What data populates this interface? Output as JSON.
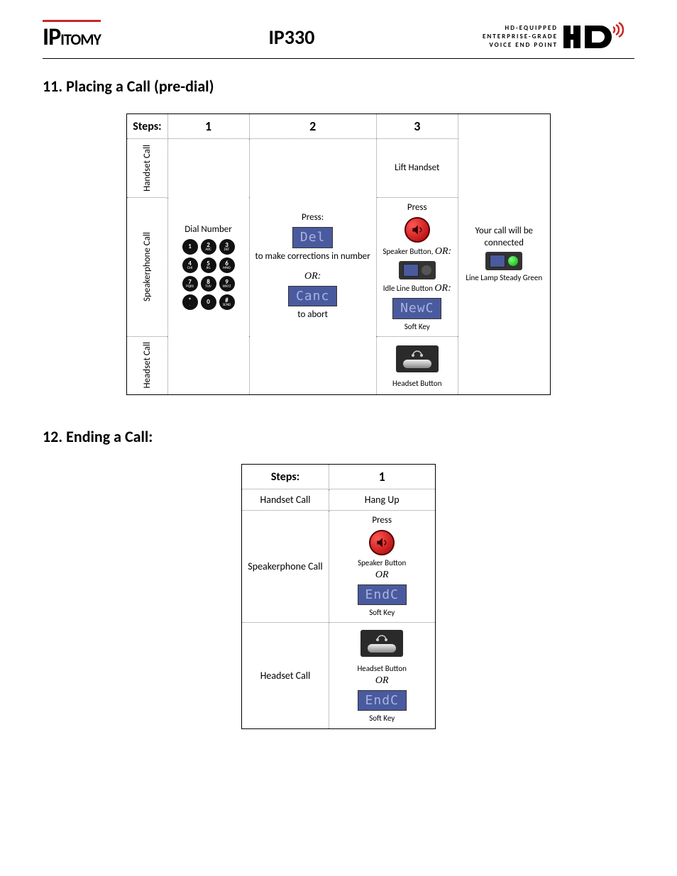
{
  "header": {
    "logo_ip": "IP",
    "logo_itomy": "ITOMY",
    "model": "IP330",
    "tag1": "HD-EQUIPPED",
    "tag2": "ENTERPRISE-GRADE",
    "tag3": "VOICE END POINT",
    "hd": "HD"
  },
  "section11": {
    "title": "11. Placing a Call (pre-dial)",
    "steps_label": "Steps:",
    "steps": [
      "1",
      "2",
      "3"
    ],
    "rows": {
      "handset": "Handset Call",
      "speaker": "Speakerphone Call",
      "headset": "Headset Call"
    },
    "c1": {
      "dial": "Dial Number"
    },
    "c2": {
      "press": "Press:",
      "del": "Del",
      "correct": "to make corrections in number",
      "or": "OR:",
      "canc": "Canc",
      "abort": "to abort"
    },
    "c3": {
      "lift": "Lift Handset",
      "press": "Press",
      "spk_label": "Speaker Button,",
      "or1": "OR:",
      "idle_label": "Idle Line Button",
      "or2": "OR:",
      "newc": "NewC",
      "softkey": "Soft Key",
      "headset_label": "Headset Button"
    },
    "result": {
      "connected": "Your call will be connected",
      "lamp": "Line Lamp Steady Green"
    }
  },
  "section12": {
    "title": "12. Ending a Call:",
    "steps_label": "Steps:",
    "step": "1",
    "rows": {
      "handset": "Handset Call",
      "speaker": "Speakerphone Call",
      "headset": "Headset Call"
    },
    "handset_action": "Hang Up",
    "press": "Press",
    "spk_label": "Speaker Button",
    "or": "OR",
    "endc": "EndC",
    "softkey": "Soft Key",
    "headset_label": "Headset Button"
  },
  "keypad": [
    {
      "n": "1",
      "l": ""
    },
    {
      "n": "2",
      "l": "ABC"
    },
    {
      "n": "3",
      "l": "DEF"
    },
    {
      "n": "4",
      "l": "GHI"
    },
    {
      "n": "5",
      "l": "JKL"
    },
    {
      "n": "6",
      "l": "MNO"
    },
    {
      "n": "7",
      "l": "PQRS"
    },
    {
      "n": "8",
      "l": "TUV"
    },
    {
      "n": "9",
      "l": "WXYZ"
    },
    {
      "n": "*",
      "l": "."
    },
    {
      "n": "0",
      "l": ""
    },
    {
      "n": "#",
      "l": "SEND"
    }
  ]
}
